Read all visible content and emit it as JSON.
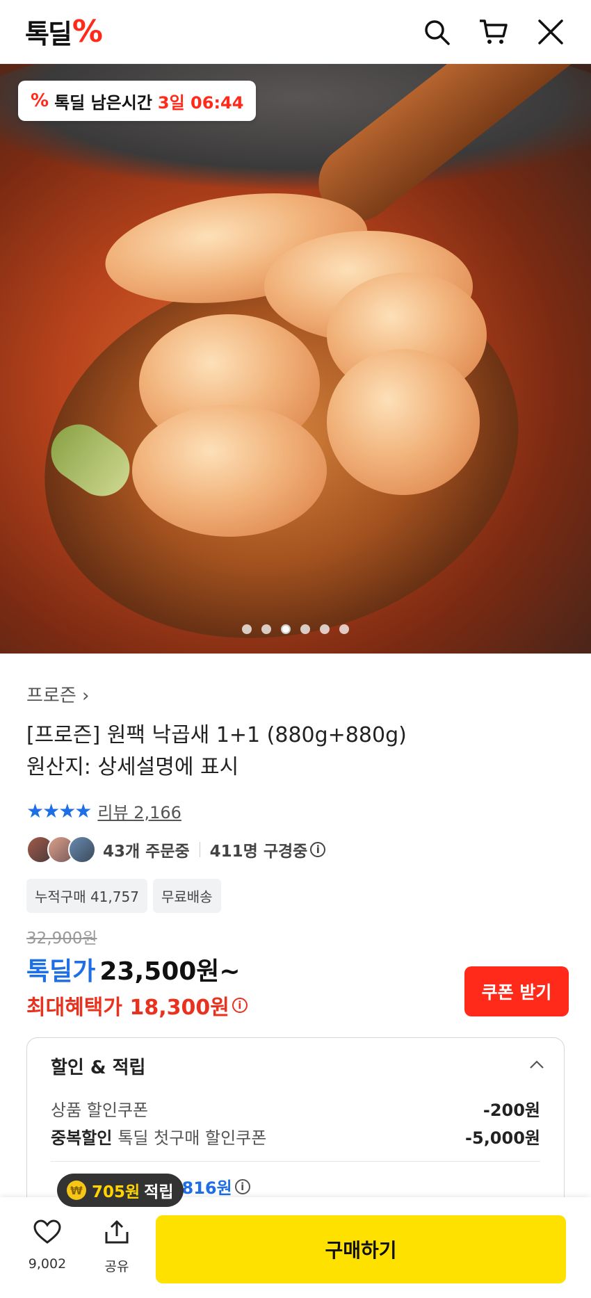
{
  "header": {
    "logo_text": "톡딜",
    "logo_symbol": "%",
    "icons": [
      "search-icon",
      "cart-icon",
      "close-icon"
    ]
  },
  "hero": {
    "timer_label": "톡딜 남은시간",
    "timer_value": "3일 06:44",
    "carousel": {
      "total": 6,
      "active_index": 2
    }
  },
  "product": {
    "brand": "프로즌",
    "title_line1": "[프로즌] 원팩 낙곱새 1+1 (880g+880g)",
    "title_line2": "원산지: 상세설명에 표시",
    "rating_stars": 4,
    "review_text": "리뷰 2,166",
    "orders_text": "43개 주문중",
    "viewers_text": "411명 구경중",
    "tags": [
      "누적구매 41,757",
      "무료배송"
    ]
  },
  "price": {
    "original": "32,900원",
    "deal_label": "톡딜가",
    "deal_price": "23,500원~",
    "max_benefit": "최대혜택가 18,300원",
    "coupon_button": "쿠폰 받기"
  },
  "discount": {
    "header": "할인 & 적립",
    "rows": [
      {
        "label": "상품 할인쿠폰",
        "bold": "",
        "amount": "-200원"
      },
      {
        "label": "톡딜 첫구매 할인쿠폰",
        "bold": "중복할인",
        "amount": "-5,000원"
      }
    ],
    "points_max": "최대 816원"
  },
  "points_tooltip": {
    "amount": "705원",
    "suffix": "적립"
  },
  "bottom_bar": {
    "like_count": "9,002",
    "share_label": "공유",
    "buy_button": "구매하기"
  },
  "colors": {
    "accent_blue": "#1e6ee6",
    "accent_red": "#ff2a1a",
    "buy_yellow": "#ffe100"
  }
}
